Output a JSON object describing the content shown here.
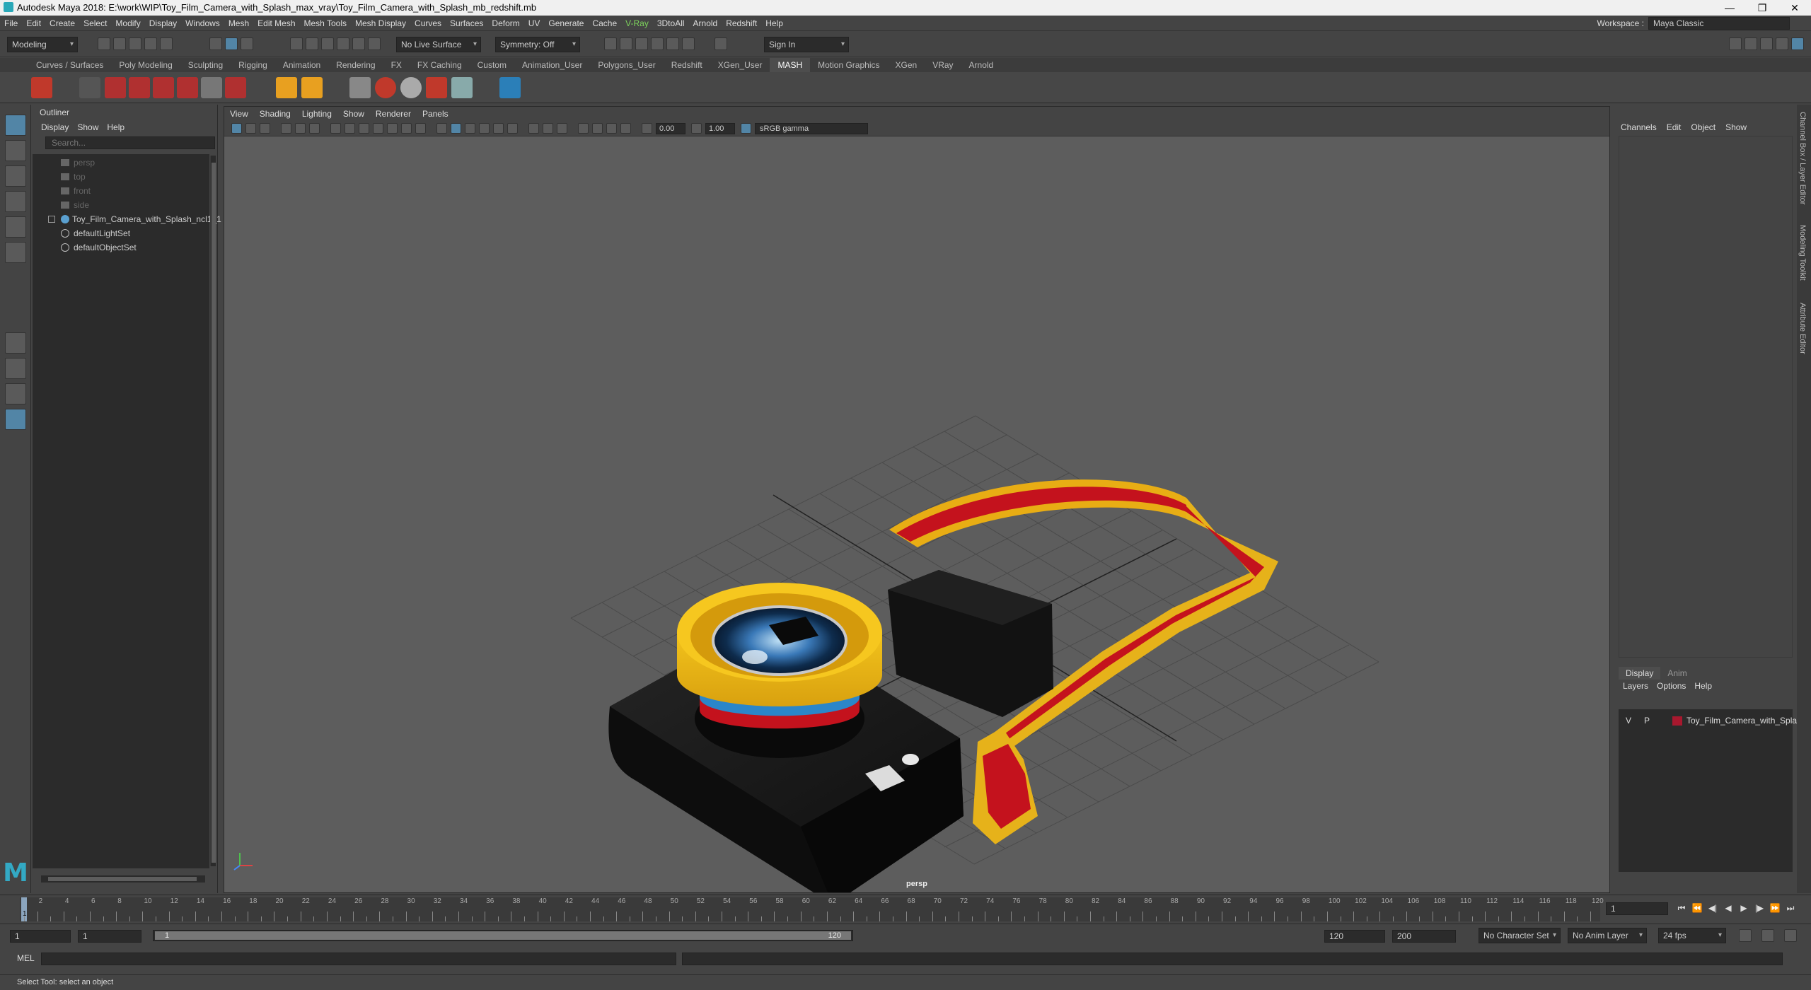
{
  "window": {
    "title": "Autodesk Maya 2018: E:\\work\\WIP\\Toy_Film_Camera_with_Splash_max_vray\\Toy_Film_Camera_with_Splash_mb_redshift.mb",
    "minimize": "—",
    "restore": "❐",
    "close": "✕"
  },
  "menubar": {
    "items": [
      "File",
      "Edit",
      "Create",
      "Select",
      "Modify",
      "Display",
      "Windows",
      "Mesh",
      "Edit Mesh",
      "Mesh Tools",
      "Mesh Display",
      "Curves",
      "Surfaces",
      "Deform",
      "UV",
      "Generate",
      "Cache",
      "V-Ray",
      "3DtoAll",
      "Arnold",
      "Redshift",
      "Help"
    ],
    "workspace_label": "Workspace :",
    "workspace_value": "Maya Classic"
  },
  "statusline": {
    "mode": "Modeling",
    "live_surface": "No Live Surface",
    "symmetry": "Symmetry: Off",
    "sign_in": "Sign In"
  },
  "shelf_tabs": [
    "Curves / Surfaces",
    "Poly Modeling",
    "Sculpting",
    "Rigging",
    "Animation",
    "Rendering",
    "FX",
    "FX Caching",
    "Custom",
    "Animation_User",
    "Polygons_User",
    "Redshift",
    "XGen_User",
    "MASH",
    "Motion Graphics",
    "XGen",
    "VRay",
    "Arnold"
  ],
  "shelf_active": "MASH",
  "outliner": {
    "title": "Outliner",
    "menu": [
      "Display",
      "Show",
      "Help"
    ],
    "search_placeholder": "Search...",
    "items": {
      "persp": "persp",
      "top": "top",
      "front": "front",
      "side": "side",
      "group": "Toy_Film_Camera_with_Splash_ncl1_1",
      "light_set": "defaultLightSet",
      "object_set": "defaultObjectSet"
    }
  },
  "viewport": {
    "menu": [
      "View",
      "Shading",
      "Lighting",
      "Show",
      "Renderer",
      "Panels"
    ],
    "exposure": "0.00",
    "gamma": "1.00",
    "color_space": "sRGB gamma",
    "camera": "persp"
  },
  "channelbox": {
    "menu": [
      "Channels",
      "Edit",
      "Object",
      "Show"
    ]
  },
  "layer_editor": {
    "tabs": [
      "Display",
      "Anim"
    ],
    "menu": [
      "Layers",
      "Options",
      "Help"
    ],
    "layer": {
      "visible": "V",
      "playback": "P",
      "name": "Toy_Film_Camera_with_Splash",
      "color": "#a8182e"
    }
  },
  "side_tabs": [
    "Channel Box / Layer Editor",
    "Modeling Toolkit",
    "Attribute Editor"
  ],
  "timeline": {
    "ticks": [
      "2",
      "4",
      "6",
      "8",
      "10",
      "12",
      "14",
      "16",
      "18",
      "20",
      "22",
      "24",
      "26",
      "28",
      "30",
      "32",
      "34",
      "36",
      "38",
      "40",
      "42",
      "44",
      "46",
      "48",
      "50",
      "52",
      "54",
      "56",
      "58",
      "60",
      "62",
      "64",
      "66",
      "68",
      "70",
      "72",
      "74",
      "76",
      "78",
      "80",
      "82",
      "84",
      "86",
      "88",
      "90",
      "92",
      "94",
      "96",
      "98",
      "100",
      "102",
      "104",
      "106",
      "108",
      "110",
      "112",
      "114",
      "116",
      "118",
      "120"
    ],
    "playhead_label": "1",
    "current_frame": "1",
    "range_start": "1",
    "range_start_inner": "1",
    "range_thumb_start": "1",
    "range_thumb_end": "120",
    "range_end_inner": "120",
    "range_end": "200",
    "character_set": "No Character Set",
    "anim_layer": "No Anim Layer",
    "fps": "24 fps"
  },
  "commandline": {
    "label": "MEL"
  },
  "helpline": {
    "text": "Select Tool: select an object"
  }
}
